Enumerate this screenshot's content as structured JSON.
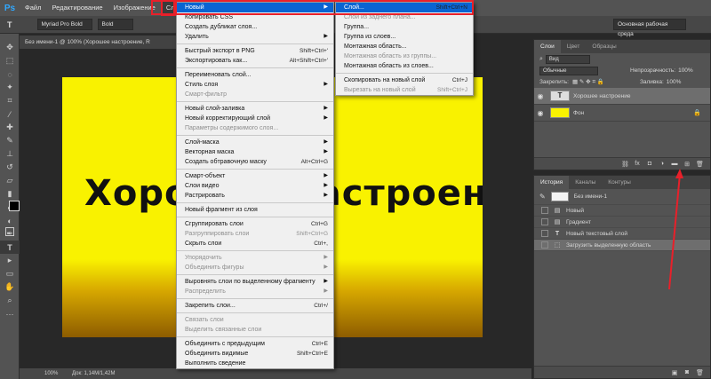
{
  "menubar": {
    "logo": "Ps",
    "items": [
      "Файл",
      "Редактирование",
      "Изображение",
      "Слои"
    ]
  },
  "options": {
    "font": "Myriad Pro Bold",
    "style": "Bold",
    "workspace": "Основная рабочая среда"
  },
  "document": {
    "tab_title": "Без имени-1 @ 100% (Хорошее настроение, R",
    "canvas_text": "Хорошее настроение",
    "status_zoom": "100%",
    "status_doc": "Док: 1,14М/1,42М"
  },
  "layers_panel": {
    "tabs": [
      "Слои",
      "Цвет",
      "Образцы"
    ],
    "kind_filter": "Вид",
    "blend_mode": "Обычные",
    "opacity_label": "Непрозрачность:",
    "opacity_value": "100%",
    "lock_label": "Закрепить:",
    "fill_label": "Заливка:",
    "fill_value": "100%",
    "layers": [
      {
        "name": "Хорошее настроение",
        "thumb": "T"
      },
      {
        "name": "Фон"
      }
    ]
  },
  "history_panel": {
    "tabs": [
      "История",
      "Каналы",
      "Контуры"
    ],
    "snapshot": "Без имени-1",
    "items": [
      "Новый",
      "Градиент",
      "Новый текстовый слой",
      "Загрузить выделенную область"
    ]
  },
  "layer_menu": {
    "items": [
      {
        "label": "Новый",
        "submenu": true,
        "highlight": true
      },
      {
        "label": "Копировать CSS"
      },
      {
        "label": "Создать дубликат слоя..."
      },
      {
        "label": "Удалить",
        "submenu": true
      },
      {
        "sep": true
      },
      {
        "label": "Быстрый экспорт в PNG",
        "shortcut": "Shift+Ctrl+'"
      },
      {
        "label": "Экспортировать как...",
        "shortcut": "Alt+Shift+Ctrl+'"
      },
      {
        "sep": true
      },
      {
        "label": "Переименовать слой..."
      },
      {
        "label": "Стиль слоя",
        "submenu": true
      },
      {
        "label": "Смарт-фильтр",
        "disabled": true
      },
      {
        "sep": true
      },
      {
        "label": "Новый слой-заливка",
        "submenu": true
      },
      {
        "label": "Новый корректирующий слой",
        "submenu": true
      },
      {
        "label": "Параметры содержимого слоя...",
        "disabled": true
      },
      {
        "sep": true
      },
      {
        "label": "Слой-маска",
        "submenu": true
      },
      {
        "label": "Векторная маска",
        "submenu": true
      },
      {
        "label": "Создать обтравочную маску",
        "shortcut": "Alt+Ctrl+G"
      },
      {
        "sep": true
      },
      {
        "label": "Смарт-объект",
        "submenu": true
      },
      {
        "label": "Слои видео",
        "submenu": true
      },
      {
        "label": "Растрировать",
        "submenu": true
      },
      {
        "sep": true
      },
      {
        "label": "Новый фрагмент из слоя"
      },
      {
        "sep": true
      },
      {
        "label": "Сгруппировать слои",
        "shortcut": "Ctrl+G"
      },
      {
        "label": "Разгруппировать слои",
        "shortcut": "Shift+Ctrl+G",
        "disabled": true
      },
      {
        "label": "Скрыть слои",
        "shortcut": "Ctrl+,"
      },
      {
        "sep": true
      },
      {
        "label": "Упорядочить",
        "submenu": true,
        "disabled": true
      },
      {
        "label": "Объединить фигуры",
        "submenu": true,
        "disabled": true
      },
      {
        "sep": true
      },
      {
        "label": "Выровнять слои по выделенному фрагменту",
        "submenu": true
      },
      {
        "label": "Распределить",
        "submenu": true,
        "disabled": true
      },
      {
        "sep": true
      },
      {
        "label": "Закрепить слои...",
        "shortcut": "Ctrl+/"
      },
      {
        "sep": true
      },
      {
        "label": "Связать слои",
        "disabled": true
      },
      {
        "label": "Выделить связанные слои",
        "disabled": true
      },
      {
        "sep": true
      },
      {
        "label": "Объединить с предыдущим",
        "shortcut": "Ctrl+E"
      },
      {
        "label": "Объединить видимые",
        "shortcut": "Shift+Ctrl+E"
      },
      {
        "label": "Выполнить сведение"
      }
    ]
  },
  "new_submenu": {
    "items": [
      {
        "label": "Слой...",
        "shortcut": "Shift+Ctrl+N",
        "highlight": true
      },
      {
        "label": "Слой из заднего плана...",
        "disabled": true
      },
      {
        "label": "Группа..."
      },
      {
        "label": "Группа из слоев..."
      },
      {
        "label": "Монтажная область..."
      },
      {
        "label": "Монтажная область из группы...",
        "disabled": true
      },
      {
        "label": "Монтажная область из слоев..."
      },
      {
        "sep": true
      },
      {
        "label": "Скопировать на новый слой",
        "shortcut": "Ctrl+J"
      },
      {
        "label": "Вырезать на новый слой",
        "shortcut": "Shift+Ctrl+J",
        "disabled": true
      }
    ]
  },
  "colors": {
    "highlight": "#0a64d2",
    "annotation": "#e8202a",
    "canvas_yellow": "#f9f200"
  }
}
